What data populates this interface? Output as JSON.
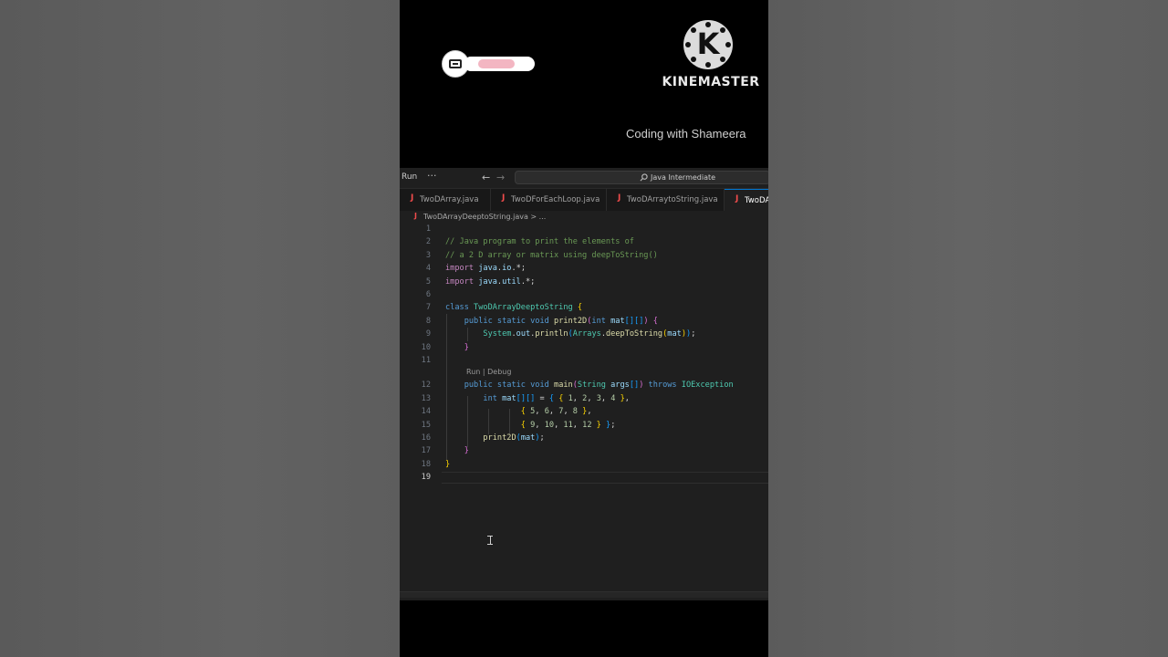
{
  "watermark": {
    "brand": "KINEMASTER",
    "logo_letter": "K",
    "overlay_caption": "Coding with Shameera"
  },
  "titlebar": {
    "menu_run": "Run",
    "more": "···",
    "back": "←",
    "forward": "→",
    "search_icon": "search-icon",
    "search_text": "Java Intermediate"
  },
  "tabs": [
    {
      "icon": "J",
      "label": "TwoDArray.java",
      "active": false
    },
    {
      "icon": "J",
      "label": "TwoDForEachLoop.java",
      "active": false
    },
    {
      "icon": "J",
      "label": "TwoDArraytoString.java",
      "active": false
    },
    {
      "icon": "J",
      "label": "TwoDArrayDeeptoString.java",
      "active": true
    }
  ],
  "breadcrumb": {
    "icon": "J",
    "text": "TwoDArrayDeeptoString.java > ..."
  },
  "editor": {
    "line_numbers": [
      "1",
      "2",
      "3",
      "4",
      "5",
      "6",
      "7",
      "8",
      "9",
      "10",
      "11",
      "12",
      "13",
      "14",
      "15",
      "16",
      "17",
      "18",
      "19"
    ],
    "current_line": "19",
    "codelens": "Run | Debug",
    "lines": [
      [],
      [
        [
          "c-com",
          "// Java program to print the elements of"
        ]
      ],
      [
        [
          "c-com",
          "// a 2 D array or matrix using deepToString()"
        ]
      ],
      [
        [
          "c-kw2",
          "import "
        ],
        [
          "c-var",
          "java"
        ],
        [
          "c-pl",
          "."
        ],
        [
          "c-var",
          "io"
        ],
        [
          "c-pl",
          ".*;"
        ]
      ],
      [
        [
          "c-kw2",
          "import "
        ],
        [
          "c-var",
          "java"
        ],
        [
          "c-pl",
          "."
        ],
        [
          "c-var",
          "util"
        ],
        [
          "c-pl",
          ".*;"
        ]
      ],
      [],
      [
        [
          "c-kw",
          "class "
        ],
        [
          "c-cls",
          "TwoDArrayDeeptoString "
        ],
        [
          "c-b1",
          "{"
        ]
      ],
      [
        [
          "c-pl",
          "    "
        ],
        [
          "c-kw",
          "public static void "
        ],
        [
          "c-fn",
          "print2D"
        ],
        [
          "c-b2",
          "("
        ],
        [
          "c-kw",
          "int "
        ],
        [
          "c-var",
          "mat"
        ],
        [
          "c-b3",
          "[]"
        ],
        [
          "c-b3",
          "[]"
        ],
        [
          "c-b2",
          ")"
        ],
        [
          "c-pl",
          " "
        ],
        [
          "c-b2",
          "{"
        ]
      ],
      [
        [
          "c-pl",
          "        "
        ],
        [
          "c-cls",
          "System"
        ],
        [
          "c-pl",
          "."
        ],
        [
          "c-var",
          "out"
        ],
        [
          "c-pl",
          "."
        ],
        [
          "c-fn",
          "println"
        ],
        [
          "c-b3",
          "("
        ],
        [
          "c-cls",
          "Arrays"
        ],
        [
          "c-pl",
          "."
        ],
        [
          "c-fn",
          "deepToString"
        ],
        [
          "c-b1",
          "("
        ],
        [
          "c-var",
          "mat"
        ],
        [
          "c-b1",
          ")"
        ],
        [
          "c-b3",
          ")"
        ],
        [
          "c-pl",
          ";"
        ]
      ],
      [
        [
          "c-pl",
          "    "
        ],
        [
          "c-b2",
          "}"
        ]
      ],
      [],
      [
        [
          "c-pl",
          "    "
        ],
        [
          "c-kw",
          "public static void "
        ],
        [
          "c-fn",
          "main"
        ],
        [
          "c-b2",
          "("
        ],
        [
          "c-cls",
          "String "
        ],
        [
          "c-var",
          "args"
        ],
        [
          "c-b3",
          "[]"
        ],
        [
          "c-b2",
          ")"
        ],
        [
          "c-kw",
          " throws "
        ],
        [
          "c-cls",
          "IOException"
        ]
      ],
      [
        [
          "c-pl",
          "        "
        ],
        [
          "c-kw",
          "int "
        ],
        [
          "c-var",
          "mat"
        ],
        [
          "c-b3",
          "[]"
        ],
        [
          "c-b3",
          "[]"
        ],
        [
          "c-pl",
          " = "
        ],
        [
          "c-b3",
          "{ "
        ],
        [
          "c-b1",
          "{ "
        ],
        [
          "c-num",
          "1"
        ],
        [
          "c-pl",
          ", "
        ],
        [
          "c-num",
          "2"
        ],
        [
          "c-pl",
          ", "
        ],
        [
          "c-num",
          "3"
        ],
        [
          "c-pl",
          ", "
        ],
        [
          "c-num",
          "4"
        ],
        [
          "c-b1",
          " }"
        ],
        [
          "c-pl",
          ","
        ]
      ],
      [
        [
          "c-pl",
          "                "
        ],
        [
          "c-b1",
          "{ "
        ],
        [
          "c-num",
          "5"
        ],
        [
          "c-pl",
          ", "
        ],
        [
          "c-num",
          "6"
        ],
        [
          "c-pl",
          ", "
        ],
        [
          "c-num",
          "7"
        ],
        [
          "c-pl",
          ", "
        ],
        [
          "c-num",
          "8"
        ],
        [
          "c-b1",
          " }"
        ],
        [
          "c-pl",
          ","
        ]
      ],
      [
        [
          "c-pl",
          "                "
        ],
        [
          "c-b1",
          "{ "
        ],
        [
          "c-num",
          "9"
        ],
        [
          "c-pl",
          ", "
        ],
        [
          "c-num",
          "10"
        ],
        [
          "c-pl",
          ", "
        ],
        [
          "c-num",
          "11"
        ],
        [
          "c-pl",
          ", "
        ],
        [
          "c-num",
          "12"
        ],
        [
          "c-b1",
          " }"
        ],
        [
          "c-b3",
          " }"
        ],
        [
          "c-pl",
          ";"
        ]
      ],
      [
        [
          "c-pl",
          "        "
        ],
        [
          "c-fn",
          "print2D"
        ],
        [
          "c-b3",
          "("
        ],
        [
          "c-var",
          "mat"
        ],
        [
          "c-b3",
          ")"
        ],
        [
          "c-pl",
          ";"
        ]
      ],
      [
        [
          "c-pl",
          "    "
        ],
        [
          "c-b2",
          "}"
        ]
      ],
      [
        [
          "c-b1",
          "}"
        ]
      ],
      []
    ]
  }
}
